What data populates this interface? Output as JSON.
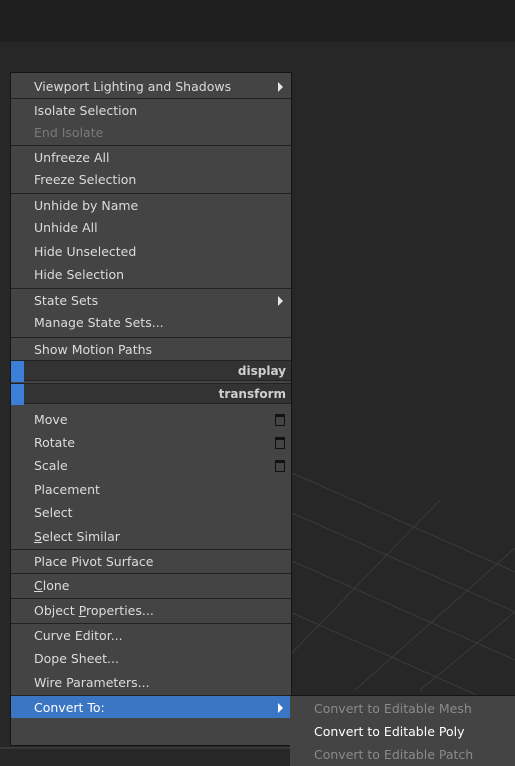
{
  "menu": {
    "items": [
      {
        "label": "Viewport Lighting and Shadows",
        "submenu": true
      },
      {
        "label": "Isolate Selection"
      },
      {
        "label": "End Isolate",
        "disabled": true
      },
      {
        "label": "Unfreeze All"
      },
      {
        "label": "Freeze Selection"
      },
      {
        "label": "Unhide by Name"
      },
      {
        "label": "Unhide All"
      },
      {
        "label": "Hide Unselected"
      },
      {
        "label": "Hide Selection"
      },
      {
        "label": "State Sets",
        "submenu": true
      },
      {
        "label": "Manage State Sets..."
      },
      {
        "label": "Show Motion Paths"
      },
      {
        "label": "Move",
        "settings": true
      },
      {
        "label": "Rotate",
        "settings": true
      },
      {
        "label": "Scale",
        "settings": true
      },
      {
        "label": "Placement"
      },
      {
        "label": "Select"
      },
      {
        "label": "Select Similar",
        "underline": "S"
      },
      {
        "label": "Place Pivot Surface"
      },
      {
        "label": "Clone",
        "underline": "C"
      },
      {
        "label": "Object Properties...",
        "underline": "P"
      },
      {
        "label": "Curve Editor..."
      },
      {
        "label": "Dope Sheet..."
      },
      {
        "label": "Wire Parameters..."
      },
      {
        "label": "Convert To:",
        "submenu": true,
        "highlighted": true
      }
    ],
    "headers": {
      "display": "display",
      "transform": "transform"
    }
  },
  "submenu": {
    "items": [
      {
        "label": "Convert to Editable Mesh"
      },
      {
        "label": "Convert to Editable Poly",
        "active": true
      },
      {
        "label": "Convert to Editable Patch"
      }
    ]
  },
  "colors": {
    "highlight": "#3a76c4",
    "header_swatch": "#3c7fd6",
    "menu_bg": "#444444",
    "viewport_bg": "#272727"
  }
}
